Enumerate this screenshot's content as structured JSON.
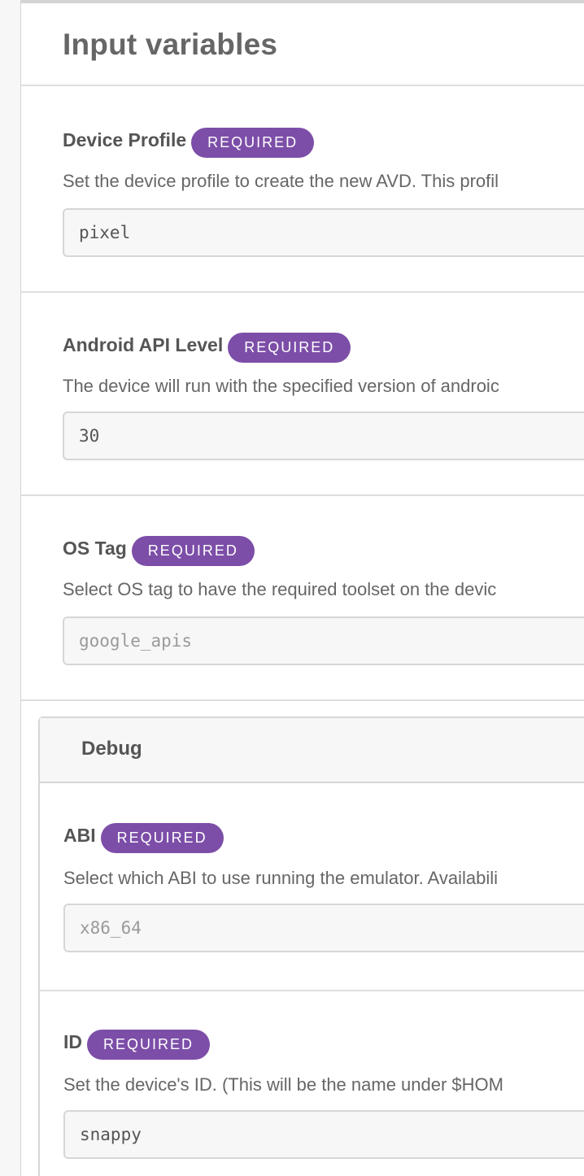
{
  "page": {
    "title": "Input variables"
  },
  "fields": [
    {
      "label": "Device Profile",
      "badge": "REQUIRED",
      "description": "Set the device profile to create the new AVD. This profil",
      "value": "pixel",
      "placeholder": ""
    },
    {
      "label": "Android API Level",
      "badge": "REQUIRED",
      "description": "The device will run with the specified version of androic",
      "value": "30",
      "placeholder": ""
    },
    {
      "label": "OS Tag",
      "badge": "REQUIRED",
      "description": "Select OS tag to have the required toolset on the devic",
      "value": "",
      "placeholder": "google_apis"
    }
  ],
  "debug": {
    "title": "Debug",
    "fields": [
      {
        "label": "ABI",
        "badge": "REQUIRED",
        "description": "Select which ABI to use running the emulator. Availabili",
        "value": "",
        "placeholder": "x86_64"
      },
      {
        "label": "ID",
        "badge": "REQUIRED",
        "description": "Set the device's ID. (This will be the name under $HOM",
        "value": "snappy",
        "placeholder": ""
      }
    ]
  },
  "colors": {
    "badge": "#7c4ea8",
    "divider": "#dedede",
    "input_bg": "#f7f7f7"
  }
}
